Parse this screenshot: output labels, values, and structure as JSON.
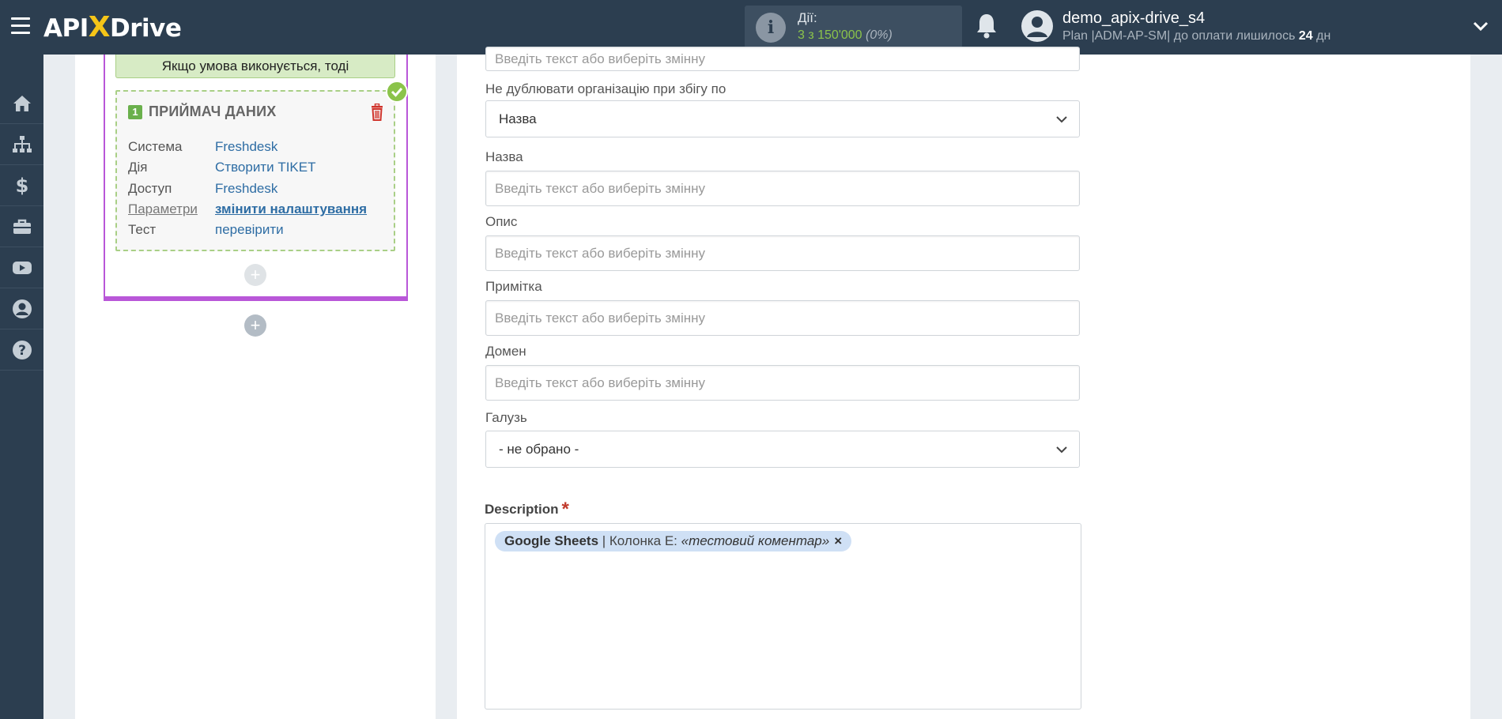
{
  "header": {
    "logo": {
      "left": "API",
      "x": "X",
      "right": "Drive"
    },
    "actions_label": "Дії:",
    "actions_count": "3 з 150'000",
    "actions_percent": "(0%)",
    "username": "demo_apix-drive_s4",
    "plan_prefix": "Plan |ADM-AP-SM| до оплати лишилось ",
    "plan_days": "24",
    "plan_suffix": " дн"
  },
  "sidebar": {
    "items": [
      {
        "name": "home-icon"
      },
      {
        "name": "sitemap-icon"
      },
      {
        "name": "dollar-icon"
      },
      {
        "name": "briefcase-icon"
      },
      {
        "name": "youtube-icon"
      },
      {
        "name": "user-circle-icon"
      },
      {
        "name": "question-circle-icon"
      }
    ]
  },
  "flow": {
    "condition_text": "Якщо умова виконується, тоді",
    "step_number": "1",
    "receiver_title": "ПРИЙМАЧ ДАНИХ",
    "rows": [
      {
        "key": "Система",
        "value": "Freshdesk"
      },
      {
        "key": "Дія",
        "value": "Створити TIKET"
      },
      {
        "key": "Доступ",
        "value": "Freshdesk"
      },
      {
        "key": "Параметри",
        "value": "змінити налаштування"
      },
      {
        "key": "Тест",
        "value": "перевірити"
      }
    ],
    "plus_label": "+"
  },
  "form": {
    "placeholder": "Введіть текст або виберіть змінну",
    "top_partial_placeholder": "Введіть текст або виберіть змінну",
    "dedupe_label": "Не дублювати організацію при збігу по",
    "dedupe_value": "Назва",
    "name_label": "Назва",
    "description_field_label": "Опис",
    "note_label": "Примітка",
    "domain_label": "Домен",
    "industry_label": "Галузь",
    "industry_value": "- не обрано -",
    "description_label": "Description",
    "required_mark": "*",
    "tag": {
      "source": "Google Sheets",
      "separator": " | Колонка E: ",
      "value": "«тестовий коментар»",
      "remove": "×"
    }
  },
  "colors": {
    "topbar": "#2c3e50",
    "accent_purple": "#b957d8",
    "success_green": "#8bc34a",
    "link_blue": "#2e6da4",
    "required_red": "#c0392b"
  }
}
